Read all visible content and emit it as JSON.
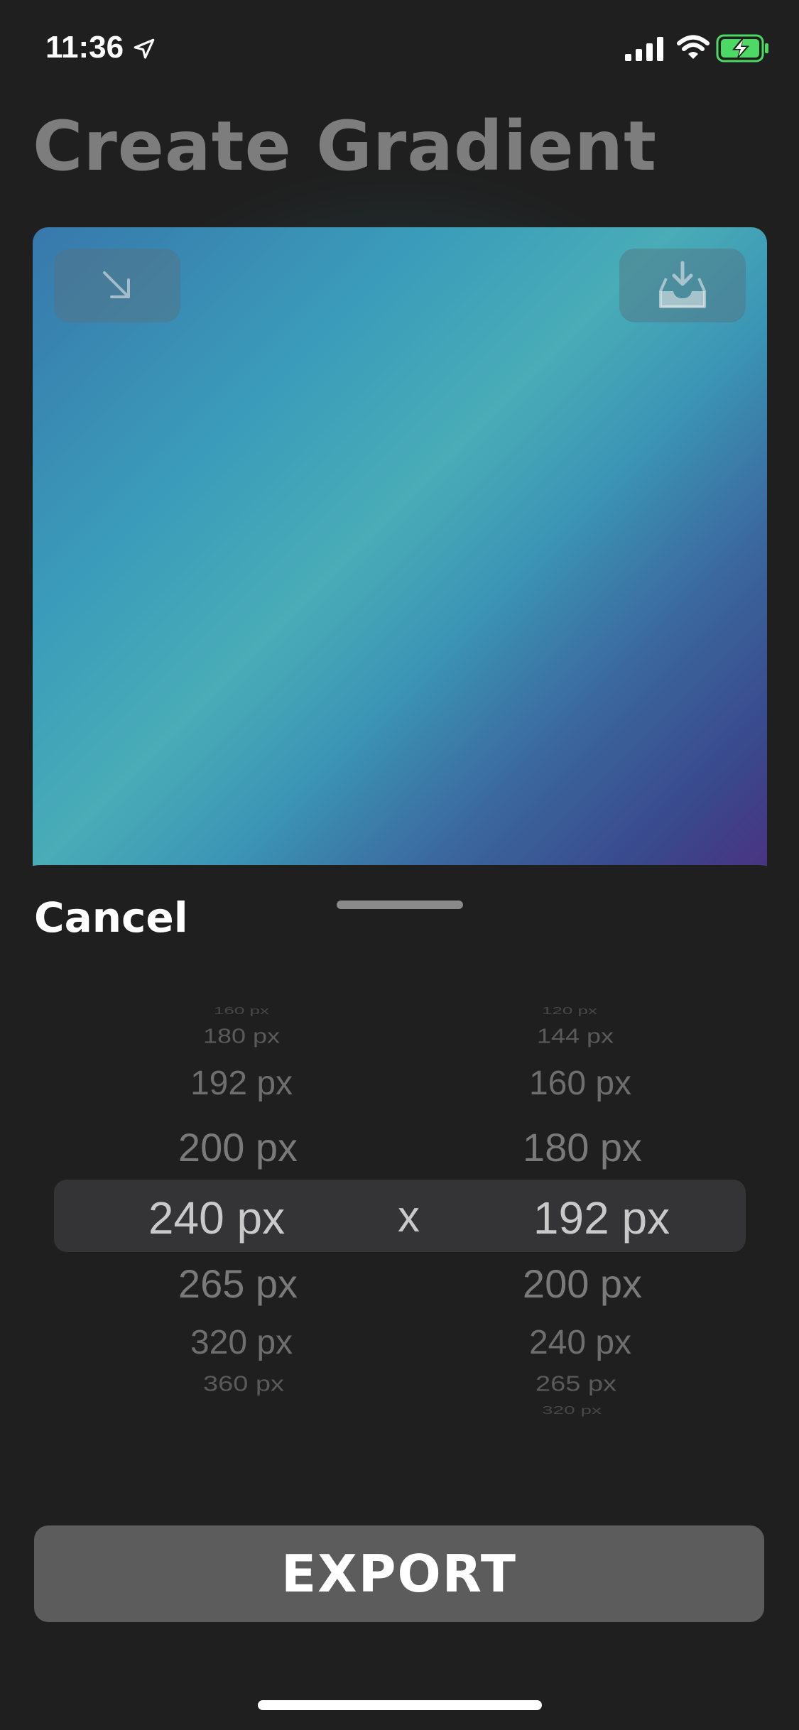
{
  "status_bar": {
    "time": "11:36"
  },
  "page": {
    "title": "Create Gradient"
  },
  "sheet": {
    "cancel_label": "Cancel",
    "separator": "x",
    "export_label": "EXPORT"
  },
  "picker": {
    "width_options": [
      "160 px",
      "180 px",
      "192 px",
      "200 px",
      "240 px",
      "265 px",
      "320 px",
      "360 px"
    ],
    "height_options": [
      "120 px",
      "144 px",
      "160 px",
      "180 px",
      "192 px",
      "200 px",
      "240 px",
      "265 px",
      "320 px"
    ],
    "selected_width": "240 px",
    "selected_height": "192 px"
  },
  "colors": {
    "gradient_stops": [
      "#3b7fb6",
      "#4db6c1",
      "#3f6fa8",
      "#532e85"
    ],
    "sheet_bg": "#1f1f1f",
    "export_button": "#5c5c5c",
    "battery_fill": "#4cd964"
  },
  "icons": [
    "location-arrow-icon",
    "signal-icon",
    "wifi-icon",
    "battery-charging-icon",
    "arrow-down-right-icon",
    "download-tray-icon"
  ]
}
